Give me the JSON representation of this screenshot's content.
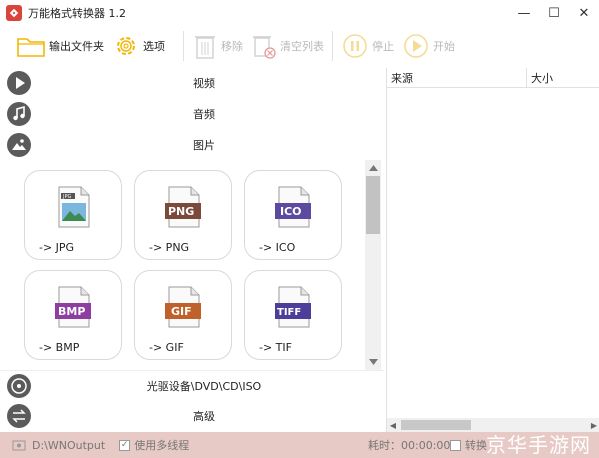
{
  "window": {
    "title": "万能格式转换器 1.2",
    "controls": {
      "minimize": "—",
      "maximize": "☐",
      "close": "✕"
    }
  },
  "toolbar": {
    "output_folder": "输出文件夹",
    "options": "选项",
    "remove": "移除",
    "clear_list": "清空列表",
    "stop": "停止",
    "start": "开始"
  },
  "categories": {
    "video": "视频",
    "audio": "音频",
    "image": "图片",
    "disc": "光驱设备\\DVD\\CD\\ISO",
    "advanced": "高级"
  },
  "formats": [
    {
      "badge": "JPG",
      "caption": "-> JPG",
      "color": "#3a6fb0"
    },
    {
      "badge": "PNG",
      "caption": "-> PNG",
      "color": "#7b4a3b"
    },
    {
      "badge": "ICO",
      "caption": "-> ICO",
      "color": "#5b4aa0"
    },
    {
      "badge": "BMP",
      "caption": "-> BMP",
      "color": "#8e3ea0"
    },
    {
      "badge": "GIF",
      "caption": "-> GIF",
      "color": "#c0612b"
    },
    {
      "badge": "TIFF",
      "caption": "-> TIF",
      "color": "#4d3e9a"
    }
  ],
  "file_list": {
    "columns": [
      "来源",
      "大小"
    ]
  },
  "status": {
    "output_path": "D:\\WNOutput",
    "multithread_label": "使用多线程",
    "elapsed": "耗时：00:00:00",
    "convert_label": "转换",
    "watermark": "京华手游网"
  },
  "colors": {
    "accent": "#f2b705",
    "statusbar": "#e7c9c5",
    "logo": "#d9453b"
  }
}
